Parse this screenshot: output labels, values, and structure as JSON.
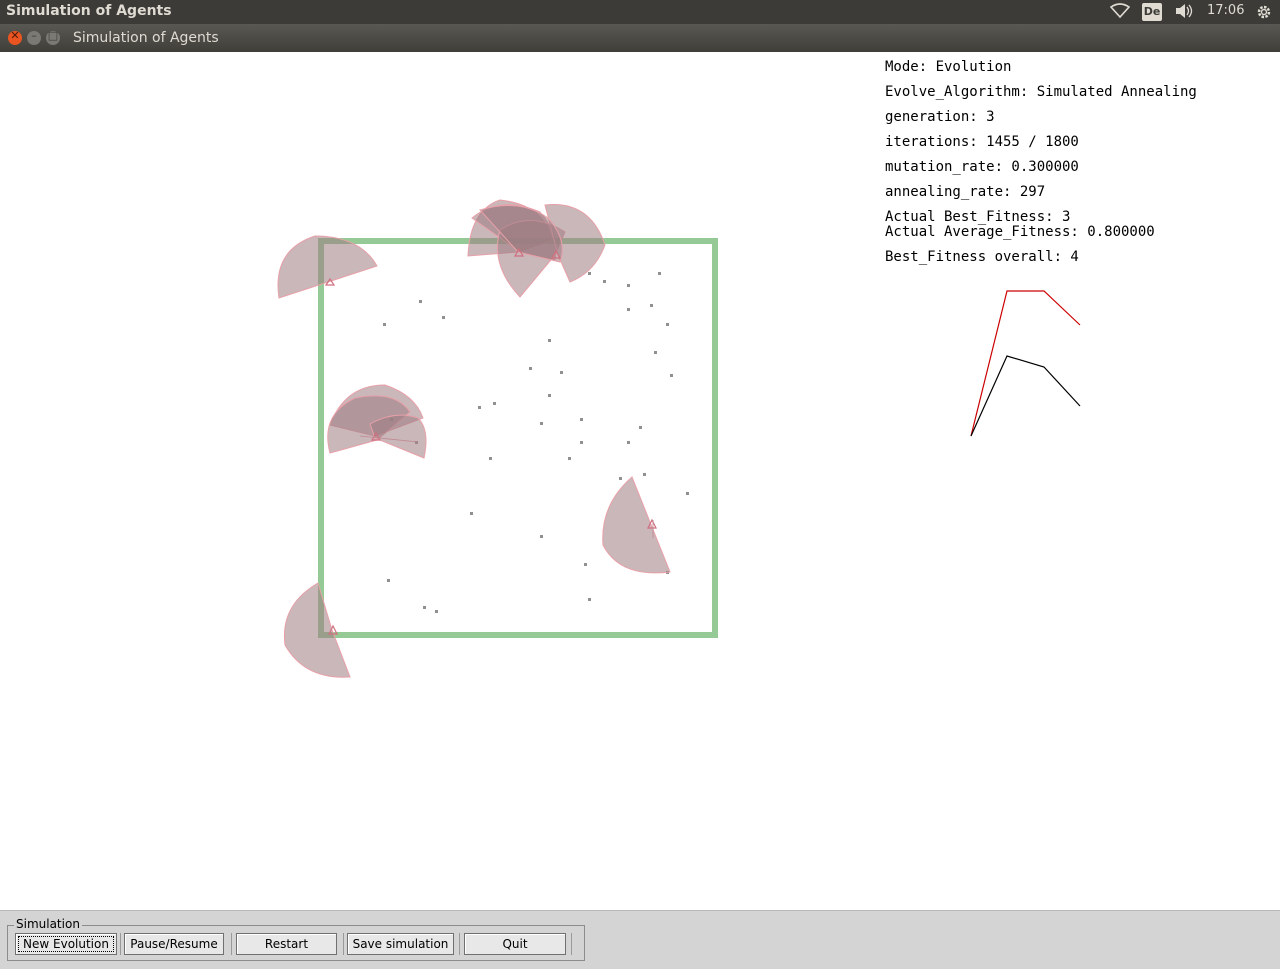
{
  "desktop": {
    "title": "Simulation of Agents",
    "keyboard_layout": "De",
    "time": "17:06",
    "icons": [
      "wifi-icon",
      "volume-icon",
      "settings-gear-icon"
    ]
  },
  "window": {
    "title": "Simulation of Agents"
  },
  "info": {
    "mode": "Mode: Evolution",
    "algorithm": "Evolve_Algorithm: Simulated Annealing",
    "generation": "generation: 3",
    "iterations": "iterations: 1455 / 1800",
    "mutation_rate": "mutation_rate: 0.300000",
    "annealing_rate": "annealing_rate: 297",
    "actual_best": "Actual Best_Fitness: 3",
    "actual_average": "Actual Average_Fitness: 0.800000",
    "best_overall": "Best_Fitness overall: 4"
  },
  "colors": {
    "arena_border": "#8fc68f",
    "agent_fill": "#9c7c82",
    "agent_edge": "#e8a0a8",
    "food_dot": "#909090",
    "best_line": "#cc0000",
    "avg_line": "#000000"
  },
  "fitness_plot": {
    "best": [
      0,
      4,
      4,
      3
    ],
    "average": [
      0,
      2.2,
      1.9,
      0.8
    ]
  },
  "controls": {
    "group_label": "Simulation",
    "new_evolution": "New Evolution",
    "pause_resume": "Pause/Resume",
    "restart": "Restart",
    "save_simulation": "Save simulation",
    "quit": "Quit"
  }
}
